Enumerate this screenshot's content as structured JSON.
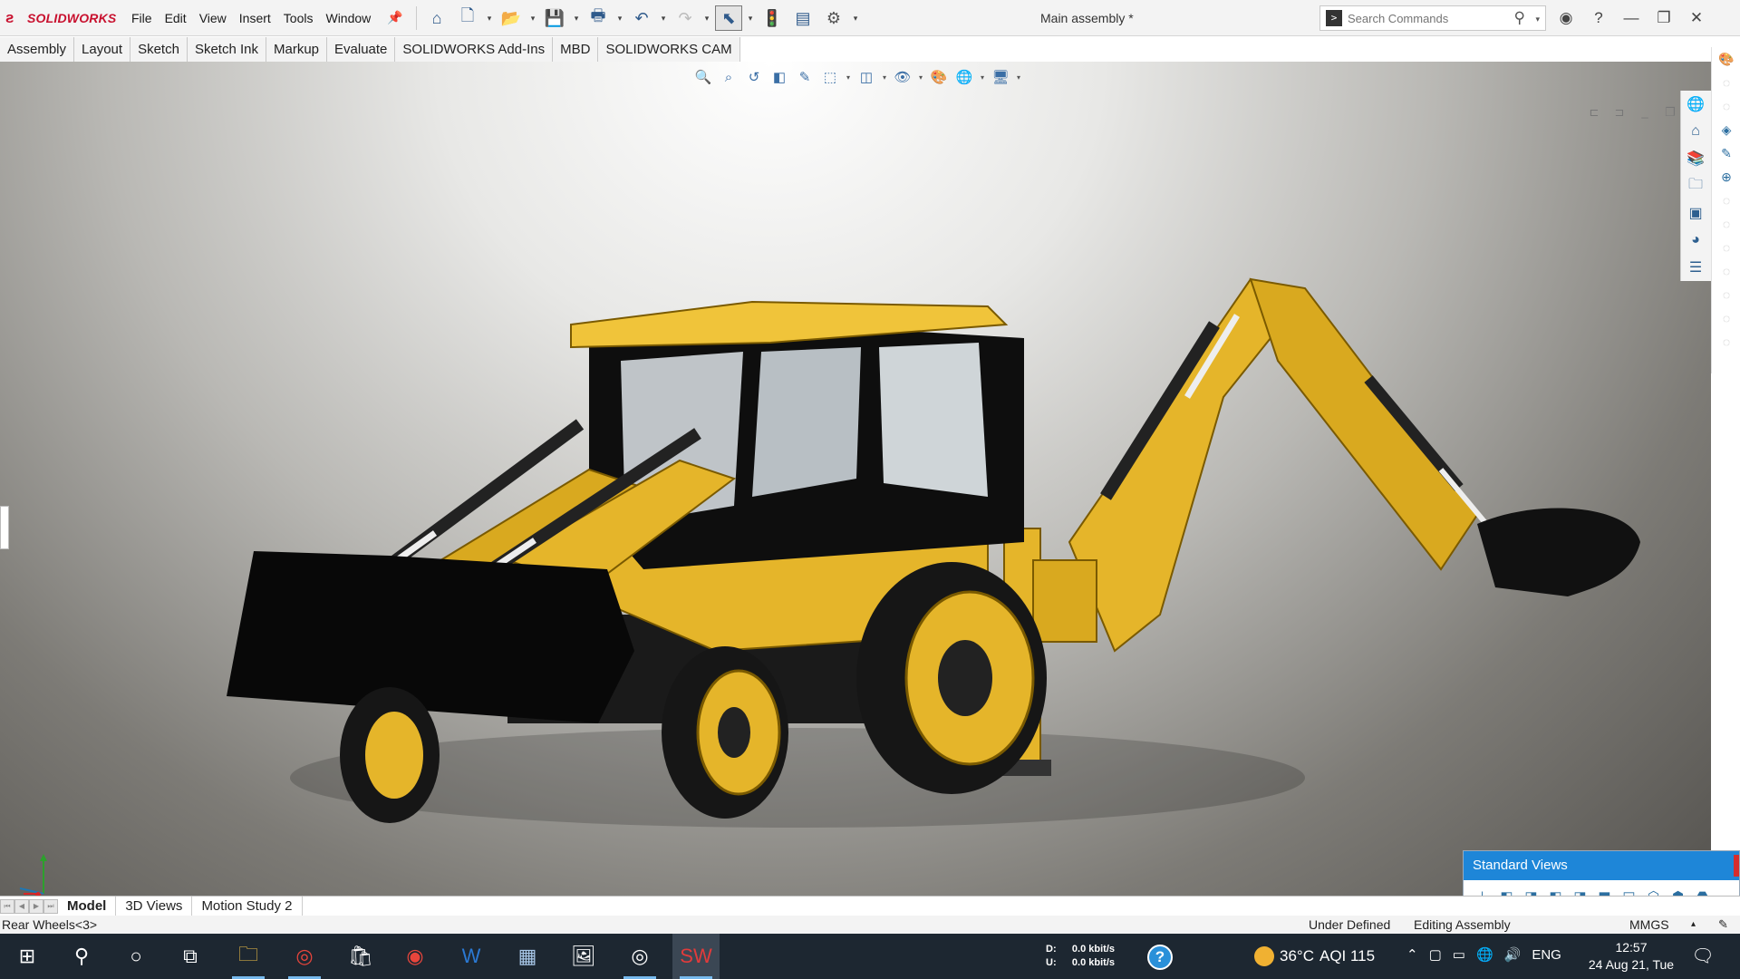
{
  "app": {
    "logo_text": "SOLIDWORKS",
    "doc_title": "Main assembly *"
  },
  "menu": [
    "File",
    "Edit",
    "View",
    "Insert",
    "Tools",
    "Window"
  ],
  "search": {
    "placeholder": "Search Commands"
  },
  "command_tabs": [
    "Assembly",
    "Layout",
    "Sketch",
    "Sketch Ink",
    "Markup",
    "Evaluate",
    "SOLIDWORKS Add-Ins",
    "MBD",
    "SOLIDWORKS CAM"
  ],
  "standard_views": {
    "title": "Standard Views"
  },
  "bottom_tabs": [
    "Model",
    "3D Views",
    "Motion Study 2"
  ],
  "status": {
    "selection": "Rear Wheels<3>",
    "state": "Under Defined",
    "mode": "Editing Assembly",
    "units": "MMGS"
  },
  "taskbar": {
    "net_down_label": "D:",
    "net_down": "0.0 kbit/s",
    "net_up_label": "U:",
    "net_up": "0.0 kbit/s",
    "temperature": "36°C",
    "aqi": "AQI 115",
    "language": "ENG",
    "time": "12:57",
    "date": "24 Aug 21, Tue"
  },
  "colors": {
    "machine_yellow": "#e5b52a",
    "brand_red": "#c8102e",
    "taskbar": "#1d2731",
    "accent_blue": "#1e86d8"
  }
}
